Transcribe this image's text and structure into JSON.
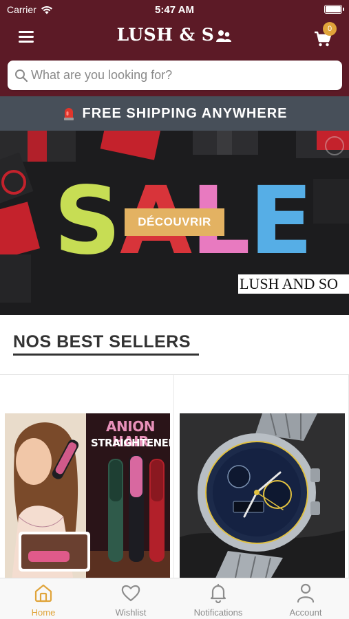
{
  "status_bar": {
    "carrier": "Carrier",
    "time": "5:47 AM"
  },
  "header": {
    "brand": "LUSH & S",
    "cart_count": "0"
  },
  "search": {
    "placeholder": "What are you looking for?"
  },
  "promo": {
    "text": "FREE SHIPPING ANYWHERE"
  },
  "banner": {
    "letters": [
      {
        "char": "S",
        "color": "#c7dd54"
      },
      {
        "char": "A",
        "color": "#d8343a"
      },
      {
        "char": "L",
        "color": "#e87ac0"
      },
      {
        "char": "E",
        "color": "#56aee6"
      }
    ],
    "button_label": "DÉCOUVRIR",
    "brand_tag": "LUSH AND SO"
  },
  "section": {
    "title": "NOS BEST SELLERS"
  },
  "products": [
    {
      "image_title": "ANION HAIR",
      "image_subtitle": "STRAIGHTENER"
    },
    {
      "image_icon": "watch-image"
    }
  ],
  "tabbar": {
    "items": [
      {
        "label": "Home",
        "icon": "home-icon",
        "active": true
      },
      {
        "label": "Wishlist",
        "icon": "heart-icon",
        "active": false
      },
      {
        "label": "Notifications",
        "icon": "bell-icon",
        "active": false
      },
      {
        "label": "Account",
        "icon": "user-icon",
        "active": false
      }
    ]
  },
  "colors": {
    "header_bg": "#5c1a26",
    "promo_bg": "#474f59",
    "accent": "#e0a43a",
    "button_gold": "#e3b262"
  }
}
